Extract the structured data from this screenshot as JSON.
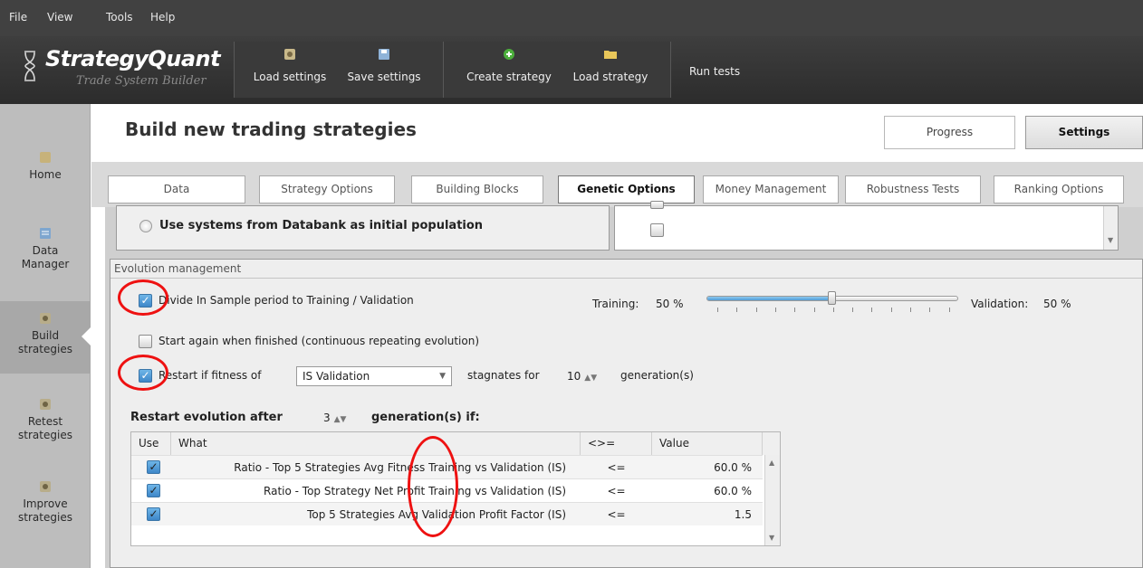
{
  "menu": [
    "File",
    "View",
    "Tools",
    "Help"
  ],
  "logo": {
    "title": "StrategyQuant",
    "subtitle": "Trade System Builder"
  },
  "toolbar": {
    "load_settings": "Load settings",
    "save_settings": "Save settings",
    "create_strategy": "Create strategy",
    "load_strategy": "Load strategy",
    "run_tests": "Run tests"
  },
  "sidebar": {
    "items": [
      {
        "label": "Home"
      },
      {
        "label": "Data Manager"
      },
      {
        "label": "Build strategies"
      },
      {
        "label": "Retest strategies"
      },
      {
        "label": "Improve strategies"
      }
    ]
  },
  "header": {
    "title": "Build new trading strategies",
    "progress": "Progress",
    "settings": "Settings"
  },
  "tabs": [
    "Data",
    "Strategy Options",
    "Building Blocks",
    "Genetic Options",
    "Money Management",
    "Robustness Tests",
    "Ranking Options"
  ],
  "init_pop": {
    "radio_label": "Use systems from Databank as initial population"
  },
  "evolution": {
    "section_label": "Evolution management",
    "divide_label": "Divide In Sample period to Training / Validation",
    "training_label": "Training:",
    "training_value": "50 %",
    "validation_label": "Validation:",
    "validation_value": "50 %",
    "training_fraction": 0.5,
    "start_again_label": "Start again when finished (continuous repeating evolution)",
    "restart_label": "Restart if fitness of",
    "restart_select": "IS Validation",
    "stagnates_label": "stagnates for",
    "stagnates_value": "10",
    "generations_label": "generation(s)",
    "restart_after_label": "Restart evolution after",
    "restart_after_value": "3",
    "restart_after_suffix": "generation(s) if:"
  },
  "table": {
    "headers": [
      "Use",
      "What",
      "<>=",
      "Value"
    ],
    "rows": [
      {
        "what": "Ratio - Top 5 Strategies Avg  Fitness Training vs Validation (IS)",
        "op": "<=",
        "value": "60.0 %"
      },
      {
        "what": "Ratio - Top Strategy Net Profit Training vs Validation (IS)",
        "op": "<=",
        "value": "60.0 %"
      },
      {
        "what": "Top 5 Strategies Avg  Validation Profit Factor (IS)",
        "op": "<=",
        "value": "1.5"
      }
    ]
  },
  "colors": {
    "accent_red": "#ee1111",
    "check_blue": "#4a90d0",
    "toolbar_bg": "#2f2f2f"
  }
}
